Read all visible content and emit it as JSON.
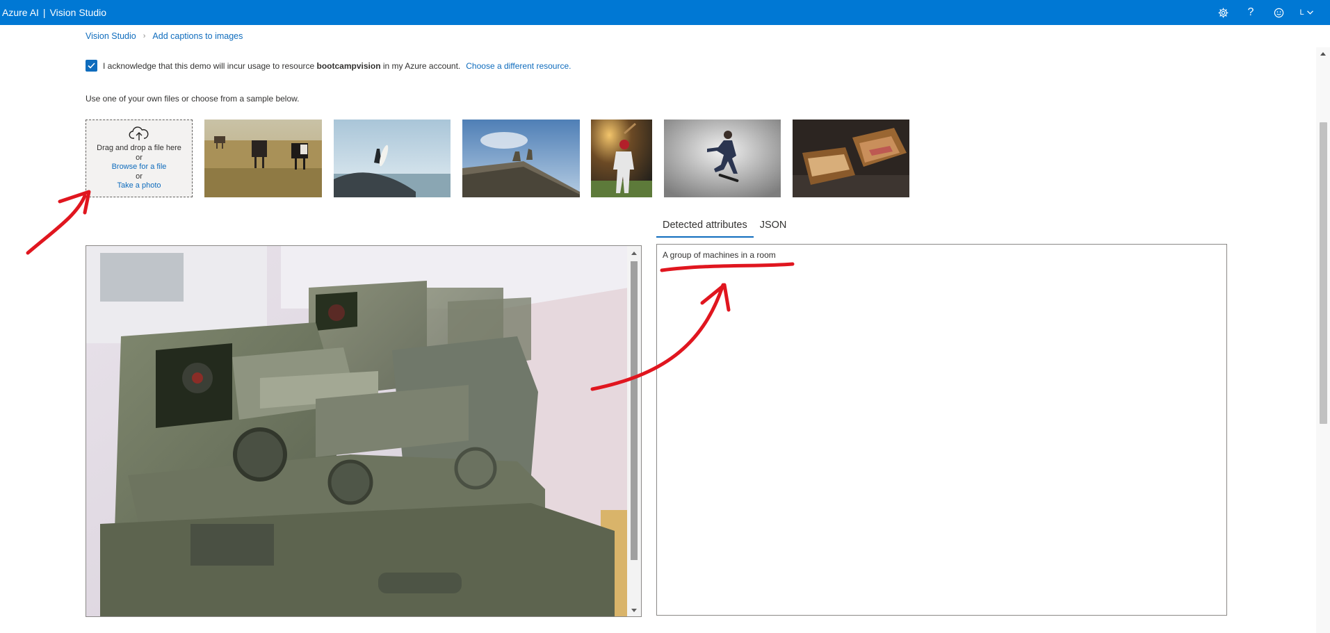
{
  "header": {
    "brand": "Azure AI",
    "brand_separator": "|",
    "product": "Vision Studio",
    "account_initial": "L"
  },
  "breadcrumb": {
    "items": [
      "Vision Studio",
      "Add captions to images"
    ]
  },
  "acknowledge": {
    "checked": true,
    "text_before": "I acknowledge that this demo will incur usage to resource",
    "resource": "bootcampvision",
    "text_after": "in my Azure account.",
    "link": "Choose a different resource."
  },
  "upload": {
    "hint": "Use one of your own files or choose from a sample below.",
    "drag_text": "Drag and drop a file here",
    "or1": "or",
    "browse": "Browse for a file",
    "or2": "or",
    "photo": "Take a photo"
  },
  "samples": [
    "cows-grazing",
    "surfer-on-rocks",
    "building-statues",
    "baseball-batter",
    "skateboarder",
    "grilled-sandwich"
  ],
  "tabs": [
    "Detected attributes",
    "JSON"
  ],
  "result": {
    "caption": "A group of machines in a room"
  },
  "colors": {
    "accent": "#0078d4",
    "link": "#0f6cbd",
    "annotation": "#e0161f"
  }
}
